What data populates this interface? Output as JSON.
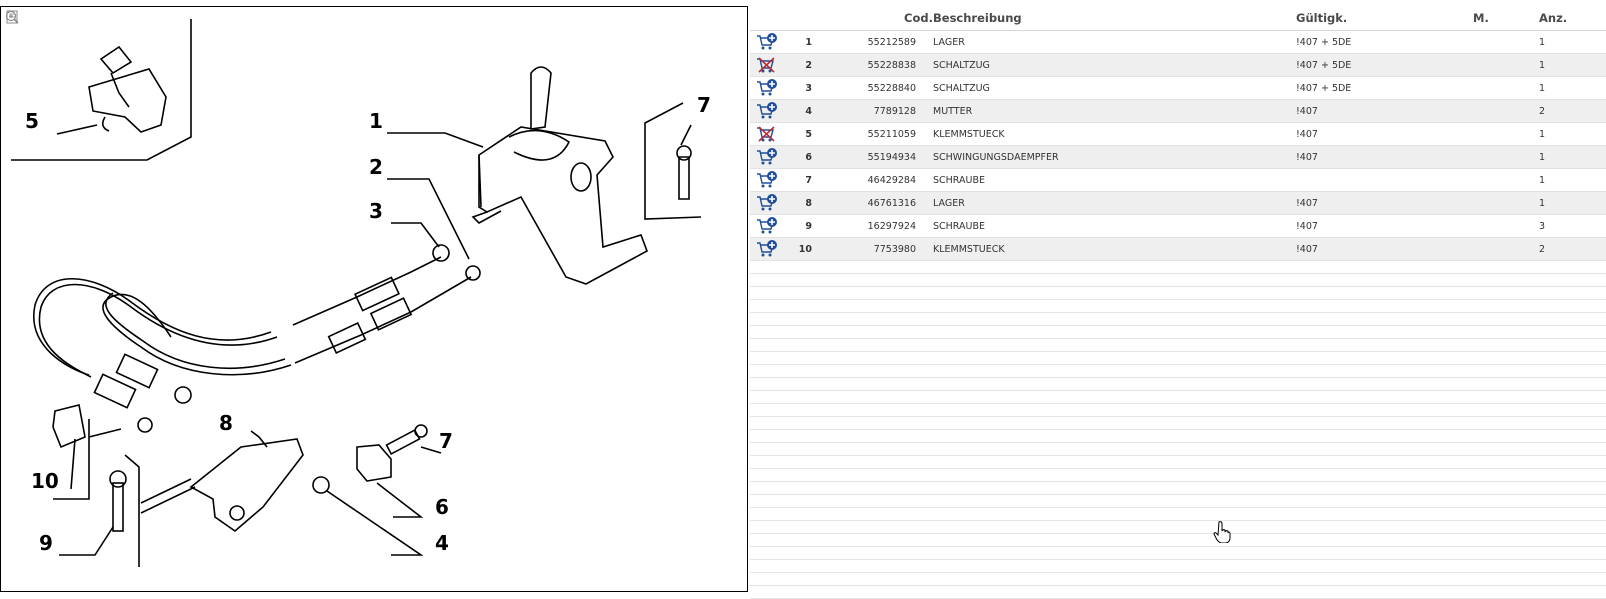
{
  "toolbar": {
    "tools": [
      "fit-page-icon",
      "zoom-in-icon",
      "zoom-out-icon"
    ]
  },
  "diagram": {
    "callouts": [
      {
        "id": "c5",
        "label": "5"
      },
      {
        "id": "c1",
        "label": "1"
      },
      {
        "id": "c2",
        "label": "2"
      },
      {
        "id": "c3",
        "label": "3"
      },
      {
        "id": "c7a",
        "label": "7"
      },
      {
        "id": "c8",
        "label": "8"
      },
      {
        "id": "c7b",
        "label": "7"
      },
      {
        "id": "c10",
        "label": "10"
      },
      {
        "id": "c6",
        "label": "6"
      },
      {
        "id": "c9",
        "label": "9"
      },
      {
        "id": "c4",
        "label": "4"
      }
    ]
  },
  "table": {
    "headers": {
      "cod": "Cod.",
      "desc": "Beschreibung",
      "valid": "Gültigk.",
      "m": "M.",
      "qty": "Anz."
    },
    "rows": [
      {
        "pos": "1",
        "cod": "55212589",
        "desc": "LAGER",
        "valid": "!407 + 5DE",
        "m": "",
        "qty": "1",
        "cart": "cart-add-icon"
      },
      {
        "pos": "2",
        "cod": "55228838",
        "desc": "SCHALTZUG",
        "valid": "!407 + 5DE",
        "m": "",
        "qty": "1",
        "cart": "cart-unavailable-icon"
      },
      {
        "pos": "3",
        "cod": "55228840",
        "desc": "SCHALTZUG",
        "valid": "!407 + 5DE",
        "m": "",
        "qty": "1",
        "cart": "cart-add-icon"
      },
      {
        "pos": "4",
        "cod": "7789128",
        "desc": "MUTTER",
        "valid": "!407",
        "m": "",
        "qty": "2",
        "cart": "cart-add-icon"
      },
      {
        "pos": "5",
        "cod": "55211059",
        "desc": "KLEMMSTUECK",
        "valid": "!407",
        "m": "",
        "qty": "1",
        "cart": "cart-unavailable-icon"
      },
      {
        "pos": "6",
        "cod": "55194934",
        "desc": "SCHWINGUNGSDAEMPFER",
        "valid": "!407",
        "m": "",
        "qty": "1",
        "cart": "cart-add-icon"
      },
      {
        "pos": "7",
        "cod": "46429284",
        "desc": "SCHRAUBE",
        "valid": "",
        "m": "",
        "qty": "1",
        "cart": "cart-add-icon"
      },
      {
        "pos": "8",
        "cod": "46761316",
        "desc": "LAGER",
        "valid": "!407",
        "m": "",
        "qty": "1",
        "cart": "cart-add-icon"
      },
      {
        "pos": "9",
        "cod": "16297924",
        "desc": "SCHRAUBE",
        "valid": "!407",
        "m": "",
        "qty": "3",
        "cart": "cart-add-icon"
      },
      {
        "pos": "10",
        "cod": "7753980",
        "desc": "KLEMMSTUECK",
        "valid": "!407",
        "m": "",
        "qty": "2",
        "cart": "cart-add-icon"
      }
    ]
  },
  "colors": {
    "cart_blue": "#1f4e9c",
    "cart_red": "#c0282d",
    "alt_row": "#efefef"
  }
}
